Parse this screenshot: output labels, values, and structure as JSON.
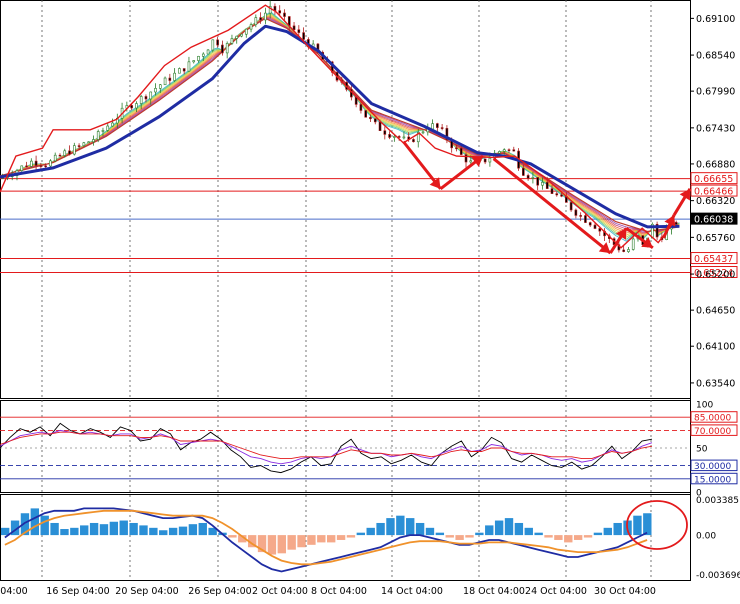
{
  "chart_data": [
    {
      "panel": "price",
      "type": "candlestick",
      "timeframe_ticks": [
        "04:00",
        "16 Sep 04:00",
        "20 Sep 04:00",
        "26 Sep 04:00",
        "2 Oct 04:00",
        "8 Oct 04:00",
        "14 Oct 04:00",
        "18 Oct 04:00",
        "24 Oct 04:00",
        "30 Oct 04:00"
      ],
      "y_ticks": [
        "0.69100",
        "0.68540",
        "0.67990",
        "0.67430",
        "0.66880",
        "0.66320",
        "0.65760",
        "0.65200",
        "0.64650",
        "0.64100",
        "0.63540"
      ],
      "ylim": [
        0.6331,
        0.6938
      ],
      "close_path": [
        [
          0,
          0.6666
        ],
        [
          3,
          0.6678
        ],
        [
          6,
          0.6692
        ],
        [
          9,
          0.6688
        ],
        [
          12,
          0.6704
        ],
        [
          15,
          0.6715
        ],
        [
          18,
          0.6728
        ],
        [
          21,
          0.6752
        ],
        [
          24,
          0.6775
        ],
        [
          27,
          0.679
        ],
        [
          30,
          0.6808
        ],
        [
          33,
          0.6825
        ],
        [
          36,
          0.6842
        ],
        [
          39,
          0.6864
        ],
        [
          40.5,
          0.688
        ],
        [
          42,
          0.6862
        ],
        [
          45,
          0.6888
        ],
        [
          48,
          0.6905
        ],
        [
          50,
          0.6918
        ],
        [
          51,
          0.693
        ],
        [
          53,
          0.6912
        ],
        [
          55,
          0.6895
        ],
        [
          57,
          0.688
        ],
        [
          59,
          0.6865
        ],
        [
          61,
          0.6845
        ],
        [
          63,
          0.6825
        ],
        [
          65,
          0.68
        ],
        [
          67,
          0.6785
        ],
        [
          69,
          0.676
        ],
        [
          71,
          0.6745
        ],
        [
          73,
          0.6735
        ],
        [
          75,
          0.673
        ],
        [
          77,
          0.672
        ],
        [
          79,
          0.6735
        ],
        [
          81,
          0.6748
        ],
        [
          83,
          0.674
        ],
        [
          85,
          0.6718
        ],
        [
          87,
          0.67
        ],
        [
          89,
          0.6688
        ],
        [
          91,
          0.6692
        ],
        [
          93,
          0.6702
        ],
        [
          95,
          0.6712
        ],
        [
          97,
          0.6705
        ],
        [
          98,
          0.668
        ],
        [
          100,
          0.6668
        ],
        [
          102,
          0.6655
        ],
        [
          104,
          0.6645
        ],
        [
          106,
          0.6632
        ],
        [
          108,
          0.6618
        ],
        [
          110,
          0.6605
        ],
        [
          112,
          0.6595
        ],
        [
          114,
          0.6578
        ],
        [
          116,
          0.6563
        ],
        [
          118,
          0.6552
        ],
        [
          120,
          0.658
        ],
        [
          121,
          0.656
        ],
        [
          123,
          0.6595
        ],
        [
          124,
          0.6572
        ],
        [
          126,
          0.659
        ],
        [
          128,
          0.6603
        ]
      ],
      "moving_averages": {
        "thick_navy": [
          [
            0,
            0.6668
          ],
          [
            10,
            0.6682
          ],
          [
            20,
            0.6712
          ],
          [
            30,
            0.676
          ],
          [
            40,
            0.6818
          ],
          [
            46,
            0.6872
          ],
          [
            50,
            0.6898
          ],
          [
            54,
            0.689
          ],
          [
            60,
            0.686
          ],
          [
            70,
            0.678
          ],
          [
            80,
            0.6745
          ],
          [
            90,
            0.6705
          ],
          [
            95,
            0.67
          ],
          [
            100,
            0.6688
          ],
          [
            108,
            0.665
          ],
          [
            116,
            0.6612
          ],
          [
            122,
            0.6592
          ],
          [
            128,
            0.6593
          ]
        ],
        "red_ribbon": [
          [
            0,
            0.667
          ],
          [
            10,
            0.669
          ],
          [
            20,
            0.673
          ],
          [
            30,
            0.6785
          ],
          [
            40,
            0.6845
          ],
          [
            46,
            0.689
          ],
          [
            50,
            0.691
          ],
          [
            54,
            0.6895
          ],
          [
            60,
            0.6855
          ],
          [
            70,
            0.677
          ],
          [
            80,
            0.674
          ],
          [
            90,
            0.6702
          ],
          [
            95,
            0.6704
          ],
          [
            100,
            0.6682
          ],
          [
            108,
            0.664
          ],
          [
            116,
            0.66
          ],
          [
            122,
            0.6585
          ],
          [
            128,
            0.6592
          ]
        ]
      },
      "horizontal_levels": [
        {
          "value": 0.66655,
          "label": "0.66655",
          "color": "#e31a1c"
        },
        {
          "value": 0.66466,
          "label": "0.66466",
          "color": "#e31a1c"
        },
        {
          "value": 0.66038,
          "label": "0.66038",
          "color": "#000000"
        },
        {
          "value": 0.65437,
          "label": "0.65437",
          "color": "#e31a1c"
        },
        {
          "value": 0.65224,
          "label": "0.65224",
          "color": "#e31a1c"
        }
      ],
      "annotations": "red arrows: drop from 0.6712 to 0.6650, rise to 0.6698 (18 Oct), drop to 0.6548 (end Oct), zigzag up toward 0.6650"
    },
    {
      "panel": "rsi_stochastic",
      "type": "line",
      "y_ticks": [
        "100",
        "85.0000",
        "70.0000",
        "50",
        "30.0000",
        "15.0000",
        "0"
      ],
      "levels": [
        85,
        70,
        30,
        15
      ],
      "series": [
        {
          "color": "#000000",
          "values": [
            50,
            62,
            72,
            68,
            74,
            64,
            78,
            70,
            66,
            72,
            68,
            62,
            74,
            70,
            58,
            60,
            72,
            66,
            48,
            56,
            60,
            68,
            60,
            48,
            40,
            28,
            30,
            24,
            22,
            26,
            34,
            40,
            30,
            32,
            52,
            60,
            44,
            38,
            40,
            32,
            36,
            42,
            34,
            30,
            44,
            52,
            58,
            40,
            48,
            62,
            56,
            38,
            34,
            42,
            36,
            30,
            28,
            34,
            26,
            30,
            40,
            52,
            38,
            46,
            58,
            60
          ]
        },
        {
          "color": "#8a2be2",
          "values": [
            52,
            58,
            64,
            66,
            68,
            66,
            70,
            68,
            66,
            68,
            66,
            64,
            66,
            66,
            60,
            62,
            66,
            62,
            54,
            56,
            58,
            60,
            58,
            52,
            46,
            40,
            38,
            34,
            32,
            34,
            38,
            40,
            38,
            40,
            48,
            52,
            48,
            44,
            44,
            40,
            42,
            44,
            40,
            38,
            44,
            48,
            52,
            46,
            48,
            54,
            52,
            46,
            42,
            44,
            42,
            38,
            36,
            38,
            34,
            36,
            42,
            48,
            44,
            46,
            52,
            56
          ]
        },
        {
          "color": "#e31a1c",
          "values": [
            54,
            58,
            62,
            64,
            66,
            66,
            68,
            68,
            66,
            66,
            66,
            64,
            64,
            64,
            62,
            62,
            64,
            62,
            58,
            58,
            58,
            58,
            58,
            54,
            50,
            46,
            42,
            40,
            38,
            38,
            40,
            40,
            40,
            40,
            44,
            48,
            46,
            44,
            44,
            42,
            42,
            44,
            42,
            40,
            42,
            46,
            48,
            46,
            46,
            50,
            50,
            46,
            44,
            44,
            42,
            40,
            40,
            40,
            38,
            38,
            42,
            46,
            44,
            46,
            50,
            52
          ]
        }
      ]
    },
    {
      "panel": "macd",
      "type": "bar",
      "y_ticks": [
        "0.0033851",
        "0.00",
        "-0.0036967"
      ],
      "ylim": [
        -0.0036967,
        0.0033851
      ],
      "histogram": [
        0.0006,
        0.0012,
        0.0018,
        0.0022,
        0.0016,
        0.001,
        0.0005,
        0.0006,
        0.0008,
        0.001,
        0.0009,
        0.0011,
        0.0012,
        0.001,
        0.0008,
        0.0006,
        0.0004,
        0.0006,
        0.0007,
        0.0009,
        0.001,
        0.0006,
        0.0002,
        -0.0002,
        -0.0006,
        -0.001,
        -0.0014,
        -0.0016,
        -0.0015,
        -0.0012,
        -0.001,
        -0.0008,
        -0.0006,
        -0.0006,
        -0.0004,
        -0.0002,
        0.0002,
        0.0006,
        0.001,
        0.0014,
        0.0016,
        0.0014,
        0.001,
        0.0006,
        0.0002,
        -0.0002,
        -0.0004,
        -0.0002,
        0.0002,
        0.0008,
        0.0012,
        0.0014,
        0.001,
        0.0006,
        0.0002,
        -0.0002,
        -0.0004,
        -0.0006,
        -0.0004,
        -0.0002,
        0.0002,
        0.0006,
        0.001,
        0.0012,
        0.0016,
        0.0018
      ],
      "lines": [
        {
          "color": "#1f2ca3",
          "values": [
            -0.0002,
            0.0004,
            0.001,
            0.0014,
            0.0018,
            0.002,
            0.002,
            0.002,
            0.0022,
            0.0022,
            0.0022,
            0.0022,
            0.0021,
            0.002,
            0.0018,
            0.0016,
            0.0014,
            0.0014,
            0.0015,
            0.0016,
            0.0014,
            0.0008,
            0.0001,
            -0.0006,
            -0.0012,
            -0.0018,
            -0.0024,
            -0.0028,
            -0.003,
            -0.0028,
            -0.0026,
            -0.0024,
            -0.0022,
            -0.002,
            -0.0018,
            -0.0016,
            -0.0014,
            -0.0012,
            -0.001,
            -0.0006,
            -0.0002,
            0.0,
            0.0,
            -0.0002,
            -0.0004,
            -0.0006,
            -0.0008,
            -0.0008,
            -0.0006,
            -0.0004,
            -0.0004,
            -0.0006,
            -0.0008,
            -0.001,
            -0.0012,
            -0.0014,
            -0.0016,
            -0.0018,
            -0.0018,
            -0.0016,
            -0.0014,
            -0.0012,
            -0.001,
            -0.0006,
            -0.0002,
            0.0002
          ]
        },
        {
          "color": "#f0922b",
          "values": [
            -0.0008,
            -0.0004,
            0.0002,
            0.0007,
            0.0011,
            0.0014,
            0.0016,
            0.0017,
            0.0018,
            0.0019,
            0.002,
            0.002,
            0.002,
            0.002,
            0.0019,
            0.0018,
            0.0017,
            0.0016,
            0.0016,
            0.0016,
            0.0016,
            0.0014,
            0.001,
            0.0005,
            -0.0001,
            -0.0007,
            -0.0012,
            -0.0017,
            -0.0021,
            -0.0023,
            -0.0024,
            -0.0024,
            -0.0023,
            -0.0022,
            -0.002,
            -0.0018,
            -0.0016,
            -0.0014,
            -0.0012,
            -0.001,
            -0.0008,
            -0.0006,
            -0.0005,
            -0.0005,
            -0.0005,
            -0.0006,
            -0.0007,
            -0.0007,
            -0.0007,
            -0.0006,
            -0.0006,
            -0.0006,
            -0.0007,
            -0.0008,
            -0.0009,
            -0.001,
            -0.0012,
            -0.0013,
            -0.0014,
            -0.0014,
            -0.0014,
            -0.0013,
            -0.0012,
            -0.001,
            -0.0007,
            -0.0004
          ]
        }
      ]
    }
  ],
  "colors": {
    "accent_red": "#e31a1c",
    "navy": "#1f2ca3",
    "macd_pos": "#2a8fd6",
    "macd_neg": "#f5a98a",
    "signal": "#f0922b"
  }
}
